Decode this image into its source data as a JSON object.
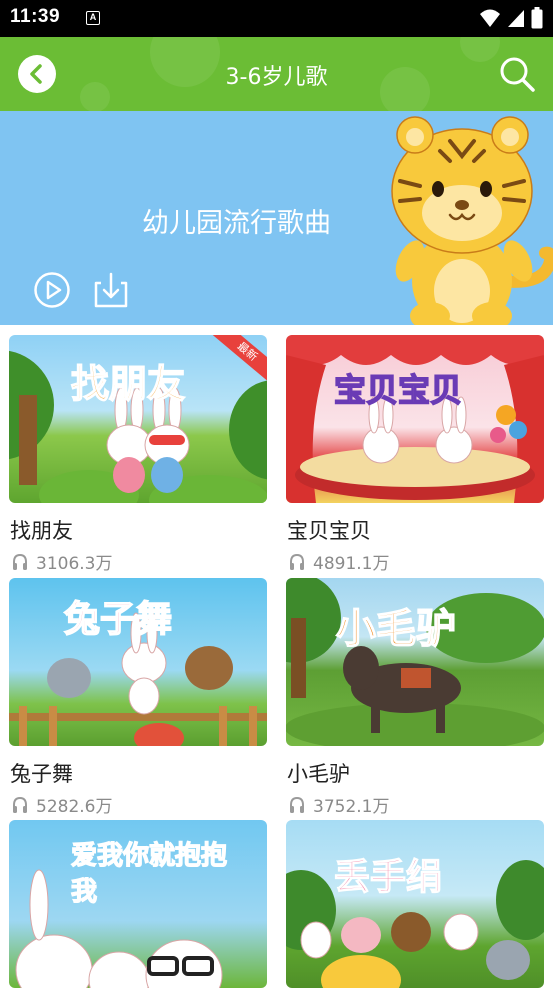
{
  "status_bar": {
    "time": "11:39",
    "notification_glyph": "A"
  },
  "app_bar": {
    "title": "3-6岁儿歌",
    "back_icon": "chevron-left-icon",
    "search_icon": "search-icon",
    "color": "#6bbd35"
  },
  "banner": {
    "title": "幼儿园流行歌曲",
    "play_icon": "play-circle-icon",
    "download_icon": "download-icon",
    "color": "#7fc4f2"
  },
  "songs": [
    {
      "title": "找朋友",
      "plays": "3106.3万",
      "art_text": "找朋友",
      "badge": "最新"
    },
    {
      "title": "宝贝宝贝",
      "plays": "4891.1万",
      "art_text": "宝贝宝贝"
    },
    {
      "title": "兔子舞",
      "plays": "5282.6万",
      "art_text": "兔子舞"
    },
    {
      "title": "小毛驴",
      "plays": "3752.1万",
      "art_text": "小毛驴"
    },
    {
      "title": "",
      "plays": "",
      "art_text": "爱我你就抱抱我"
    },
    {
      "title": "",
      "plays": "",
      "art_text": "丢手绢"
    }
  ]
}
